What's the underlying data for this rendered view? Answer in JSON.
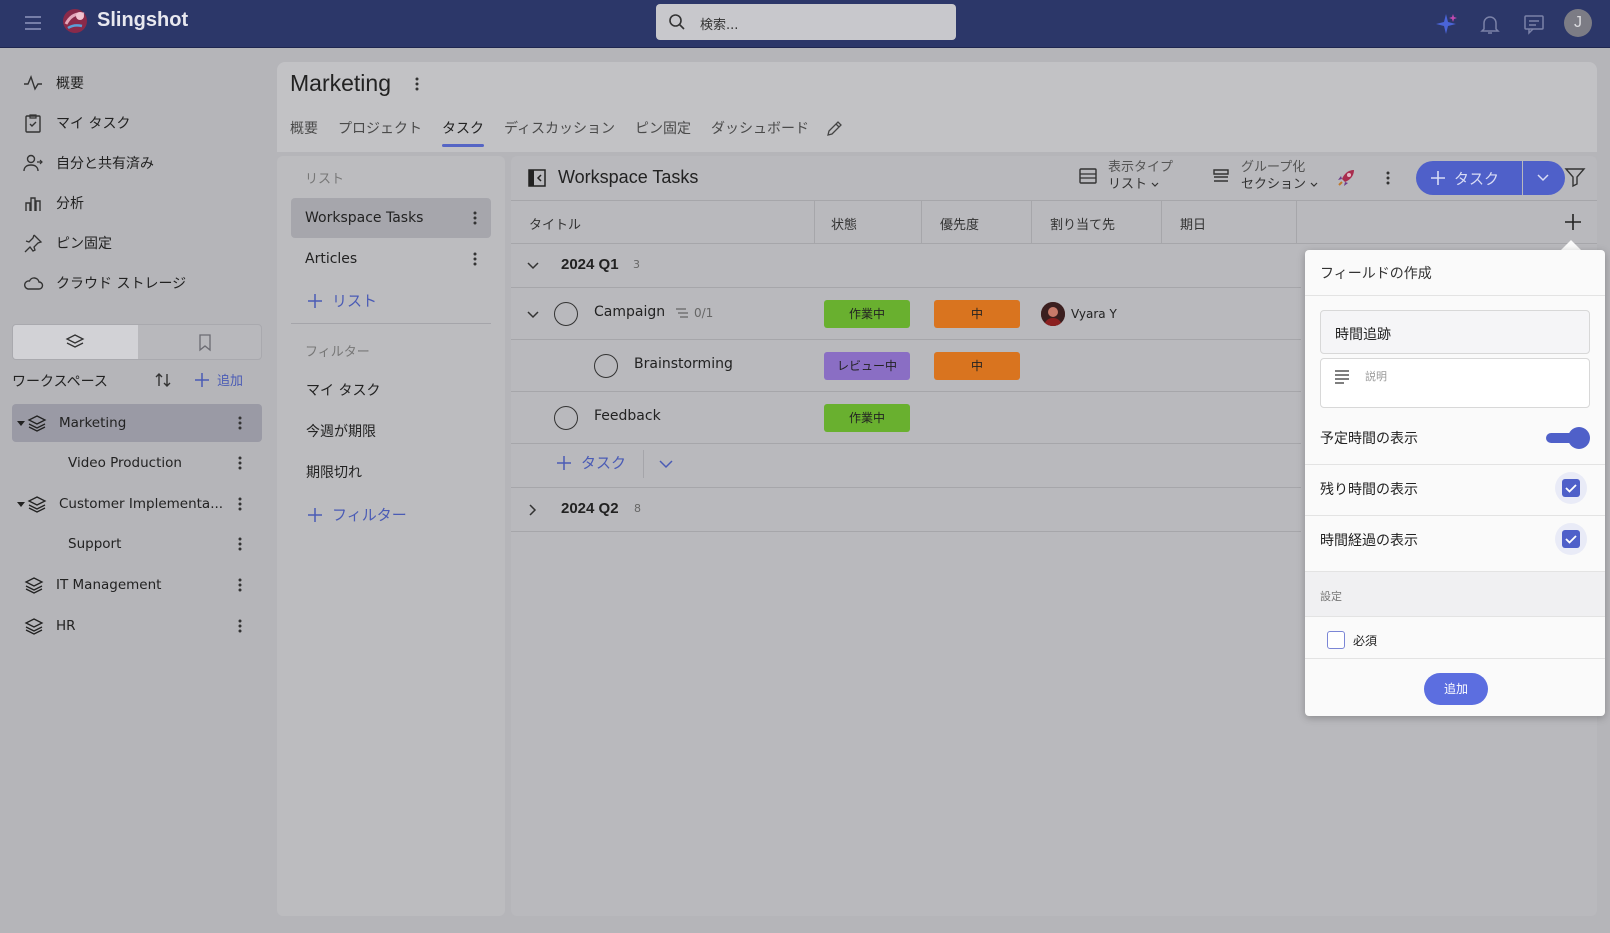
{
  "app": {
    "brand": "Slingshot",
    "avatar_initial": "J"
  },
  "search": {
    "placeholder": "検索..."
  },
  "nav": {
    "items": [
      {
        "label": "概要",
        "icon": "activity-icon"
      },
      {
        "label": "マイ タスク",
        "icon": "clipboard-check-icon"
      },
      {
        "label": "自分と共有済み",
        "icon": "shared-user-icon"
      },
      {
        "label": "分析",
        "icon": "bar-chart-icon"
      },
      {
        "label": "ピン固定",
        "icon": "pin-icon"
      },
      {
        "label": "クラウド ストレージ",
        "icon": "cloud-icon"
      }
    ]
  },
  "workspaces": {
    "heading": "ワークスペース",
    "add_label": "追加",
    "items": [
      {
        "label": "Marketing",
        "active": true
      },
      {
        "label": "Video Production"
      },
      {
        "label": "Customer Implementa..."
      },
      {
        "label": "Support"
      },
      {
        "label": "IT Management"
      },
      {
        "label": "HR"
      }
    ]
  },
  "page": {
    "title": "Marketing",
    "tabs": [
      "概要",
      "プロジェクト",
      "タスク",
      "ディスカッション",
      "ピン固定",
      "ダッシュボード"
    ],
    "active_tab": "タスク"
  },
  "lists": {
    "section_label": "リスト",
    "items": [
      "Workspace Tasks",
      "Articles"
    ],
    "add_list_label": "リスト",
    "filter_section_label": "フィルター",
    "filters": [
      "マイ タスク",
      "今週が期限",
      "期限切れ"
    ],
    "add_filter_label": "フィルター"
  },
  "tasks_panel": {
    "title": "Workspace Tasks",
    "view_type_label": "表示タイプ",
    "view_type_value": "リスト",
    "group_label": "グループ化",
    "group_value": "セクション",
    "add_task_button": "タスク",
    "columns": [
      "タイトル",
      "状態",
      "優先度",
      "割り当て先",
      "期日"
    ],
    "groups": [
      {
        "name": "2024 Q1",
        "count": "3",
        "expanded": true
      },
      {
        "name": "2024 Q2",
        "count": "8",
        "expanded": false
      }
    ],
    "tasks": [
      {
        "name": "Campaign",
        "subtasks": "0/1",
        "status": "作業中",
        "priority": "中",
        "assignee": "Vyara Y"
      },
      {
        "name": "Brainstorming",
        "status": "レビュー中",
        "priority": "中"
      },
      {
        "name": "Feedback",
        "status": "作業中"
      }
    ],
    "add_task_inline": "タスク"
  },
  "field_popup": {
    "title": "フィールドの作成",
    "field_name": "時間追跡",
    "description_placeholder": "説明",
    "options": [
      {
        "label": "予定時間の表示",
        "control": "toggle",
        "on": true
      },
      {
        "label": "残り時間の表示",
        "control": "checkbox",
        "checked": true
      },
      {
        "label": "時間経過の表示",
        "control": "checkbox",
        "checked": true
      }
    ],
    "settings_label": "設定",
    "required_label": "必須",
    "required_checked": false,
    "add_button": "追加"
  },
  "colors": {
    "topbar": "#2c3769",
    "accent": "#4f60c9",
    "status_in_progress": "#69b02f",
    "status_review": "#8a6ec4",
    "priority_medium": "#d9741f"
  }
}
